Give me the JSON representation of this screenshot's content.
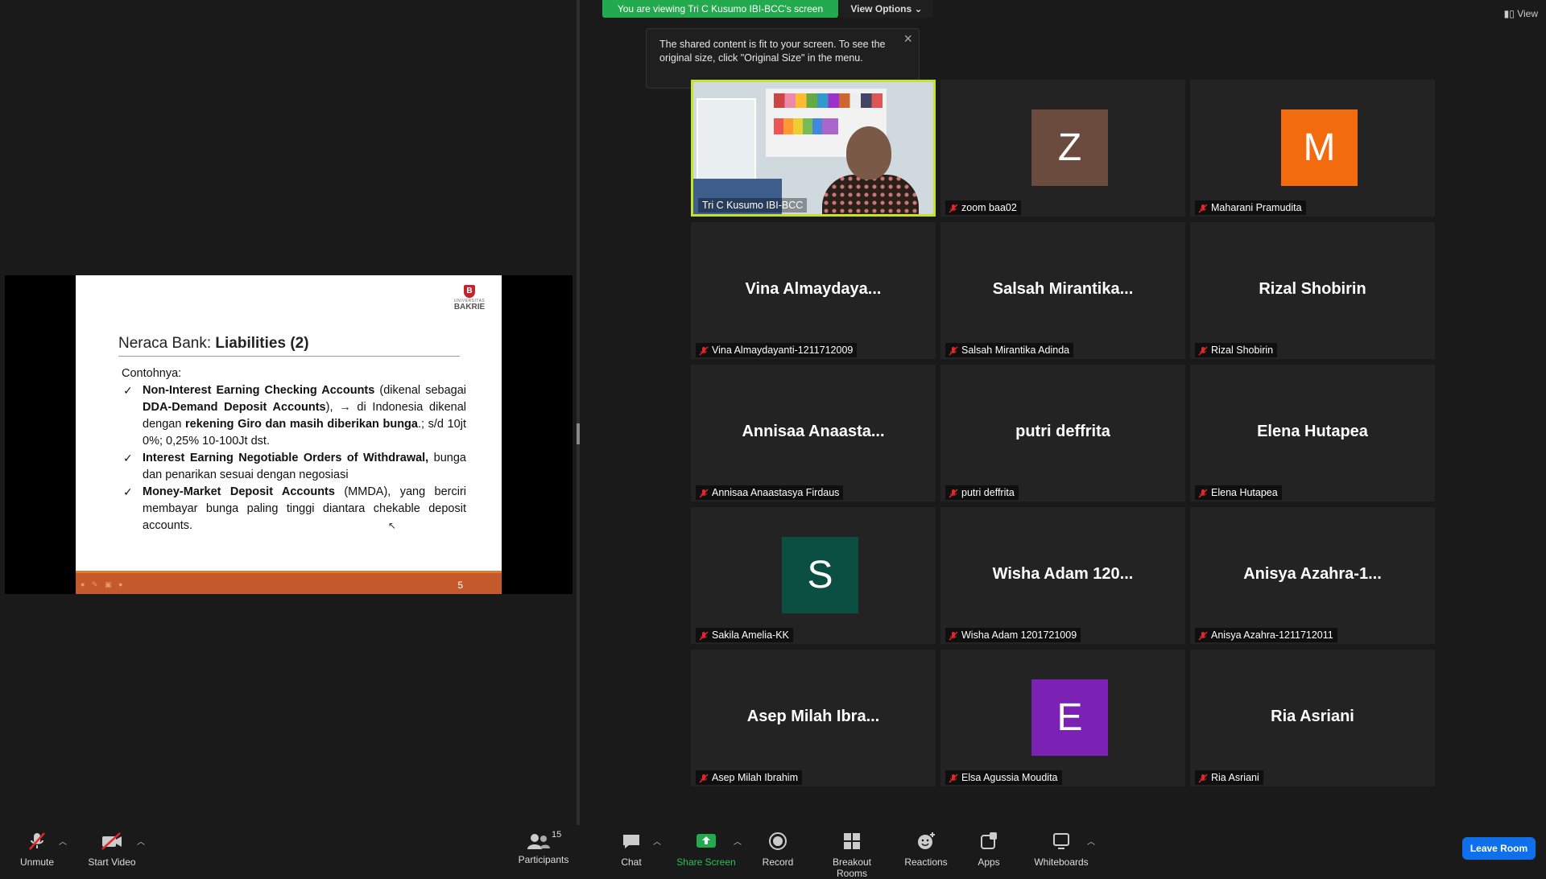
{
  "banner": {
    "viewing": "You are viewing Tri C Kusumo IBI-BCC's screen",
    "view_options": "View Options",
    "view": "View"
  },
  "tooltip": {
    "text": "The shared content is fit to your screen. To see the original size, click \"Original Size\" in the menu."
  },
  "slide": {
    "logo_univ": "UNIVERSITAS",
    "logo_brand": "BAKRIE",
    "logo_letter": "B",
    "title_prefix": "Neraca Bank: ",
    "title_bold": "Liabilities (2)",
    "intro": "Contohnya:",
    "b1_bold1": "Non-Interest Earning Checking Accounts",
    "b1_text1": " (dikenal sebagai ",
    "b1_bold2": "DDA-Demand Deposit Accounts",
    "b1_text2": "), → di Indonesia dikenal dengan ",
    "b1_bold3": "rekening Giro dan masih diberikan bunga",
    "b1_text3": ".; s/d 10jt 0%; 0,25% 10-100Jt dst.",
    "b2_bold": "Interest Earning Negotiable Orders of Withdrawal,",
    "b2_text": " bunga dan penarikan sesuai dengan negosiasi",
    "b3_bold": "Money-Market Deposit Accounts",
    "b3_text": " (MMDA), yang berciri membayar bunga paling tinggi diantara chekable deposit accounts.",
    "page": "5"
  },
  "tiles": [
    {
      "type": "video",
      "label": "Tri C Kusumo IBI-BCC"
    },
    {
      "type": "avatar",
      "letter": "Z",
      "color": "#6b4b3e",
      "label": "zoom baa02"
    },
    {
      "type": "avatar",
      "letter": "M",
      "color": "#f26b0f",
      "label": "Maharani Pramudita"
    },
    {
      "type": "name",
      "big": "Vina Almaydaya...",
      "label": "Vina Almaydayanti-1211712009"
    },
    {
      "type": "name",
      "big": "Salsah Mirantika...",
      "label": "Salsah Mirantika Adinda"
    },
    {
      "type": "name",
      "big": "Rizal Shobirin",
      "label": "Rizal Shobirin"
    },
    {
      "type": "name",
      "big": "Annisaa Anaasta...",
      "label": "Annisaa Anaastasya Firdaus"
    },
    {
      "type": "name",
      "big": "putri deffrita",
      "label": "putri deffrita"
    },
    {
      "type": "name",
      "big": "Elena Hutapea",
      "label": "Elena Hutapea"
    },
    {
      "type": "avatar",
      "letter": "S",
      "color": "#0b4f43",
      "label": "Sakila Amelia-KK"
    },
    {
      "type": "name",
      "big": "Wisha Adam 120...",
      "label": "Wisha Adam 1201721009"
    },
    {
      "type": "name",
      "big": "Anisya Azahra-1...",
      "label": "Anisya Azahra-1211712011"
    },
    {
      "type": "name",
      "big": "Asep Milah Ibra...",
      "label": "Asep Milah Ibrahim"
    },
    {
      "type": "avatar",
      "letter": "E",
      "color": "#7b22b5",
      "label": "Elsa Agussia Moudita"
    },
    {
      "type": "name",
      "big": "Ria Asriani",
      "label": "Ria Asriani"
    }
  ],
  "toolbar": {
    "unmute": "Unmute",
    "start_video": "Start Video",
    "participants": "Participants",
    "participants_count": "15",
    "chat": "Chat",
    "share_screen": "Share Screen",
    "record": "Record",
    "breakout_rooms": "Breakout Rooms",
    "reactions": "Reactions",
    "apps": "Apps",
    "whiteboards": "Whiteboards",
    "leave_room": "Leave Room"
  },
  "colors": {
    "share_green": "#23a94e",
    "active_speaker": "#c5e32e",
    "leave_blue": "#0e71eb",
    "muted_red": "#e02828"
  }
}
